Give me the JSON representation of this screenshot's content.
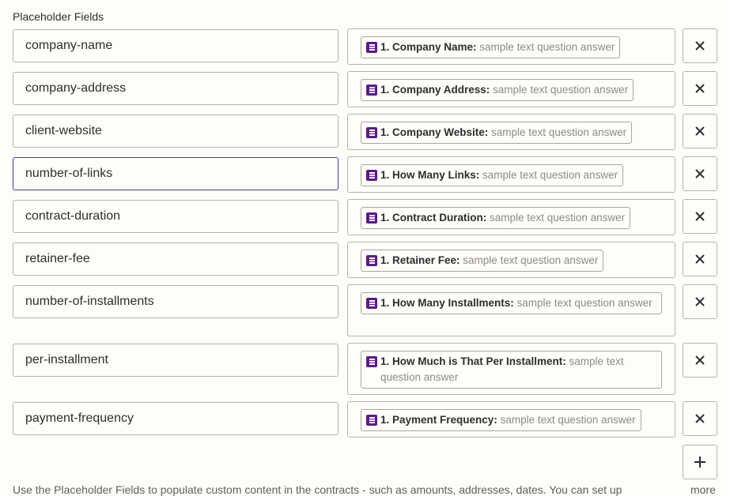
{
  "section_title": "Placeholder Fields",
  "fields": [
    {
      "key": "company-name",
      "label": "1. Company Name:",
      "sample": "sample text question answer"
    },
    {
      "key": "company-address",
      "label": "1. Company Address:",
      "sample": "sample text question answer"
    },
    {
      "key": "client-website",
      "label": "1. Company Website:",
      "sample": "sample text question answer"
    },
    {
      "key": "number-of-links",
      "label": "1. How Many Links:",
      "sample": "sample text question answer"
    },
    {
      "key": "contract-duration",
      "label": "1. Contract Duration:",
      "sample": "sample text question answer"
    },
    {
      "key": "retainer-fee",
      "label": "1. Retainer Fee:",
      "sample": "sample text question answer"
    },
    {
      "key": "number-of-installments",
      "label": "1. How Many Installments:",
      "sample": "sample text question answer"
    },
    {
      "key": "per-installment",
      "label": "1. How Much is That Per Installment:",
      "sample": "sample text question answer"
    },
    {
      "key": "payment-frequency",
      "label": "1. Payment Frequency:",
      "sample": "sample text question answer"
    }
  ],
  "help_text": "Use the Placeholder Fields to populate custom content in the contracts - such as amounts, addresses, dates. You can set up",
  "more_label": "more",
  "icons": {
    "field_icon": "google-forms-icon",
    "delete": "close-icon",
    "add": "plus-icon"
  },
  "colors": {
    "field_icon": "#5b1a8b",
    "focus_border": "#3d4592"
  }
}
